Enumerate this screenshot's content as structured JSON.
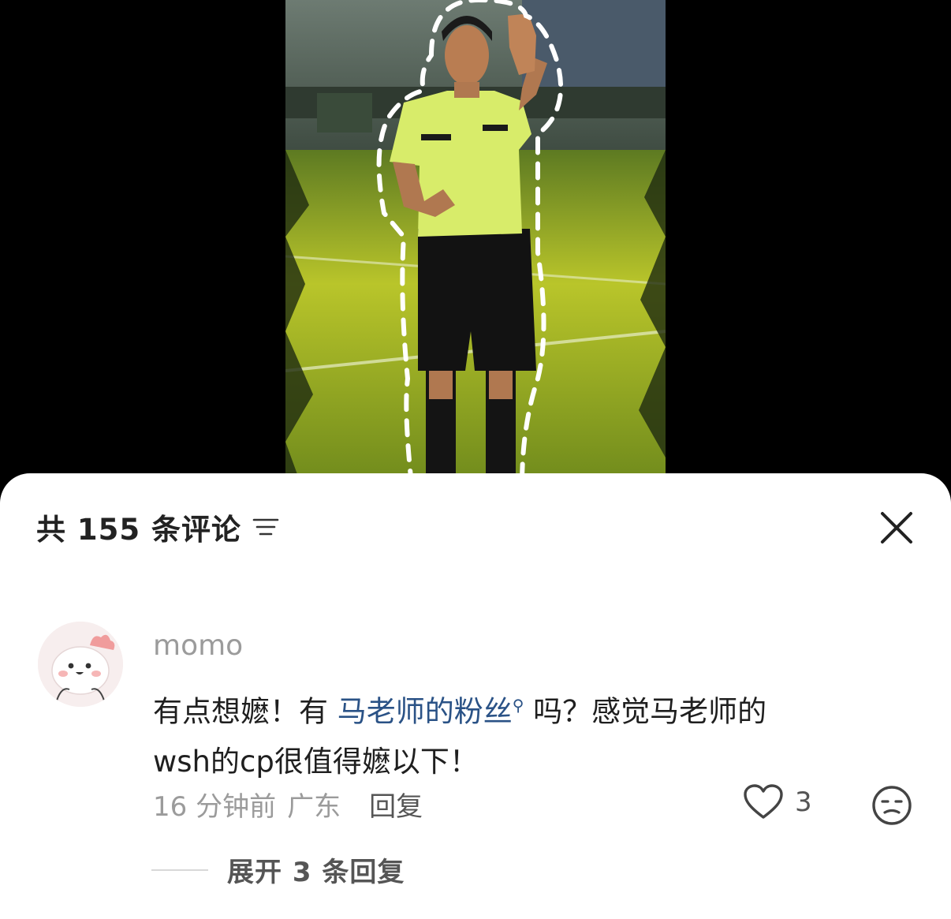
{
  "sheet": {
    "comment_count_label": "共 155 条评论"
  },
  "icons": {
    "sort": "sort-lines-icon",
    "close": "close-icon",
    "like": "heart-outline-icon",
    "dislike": "meh-face-icon",
    "search_hint": "search-icon"
  },
  "comment": {
    "username": "momo",
    "text_before": "有点想嬷！有 ",
    "mention": "马老师的粉丝",
    "text_after": " 吗？感觉马老师的",
    "text_line2": "wsh的cp很值得嬷以下！",
    "time": "16 分钟前",
    "location": "广东",
    "reply_label": "回复",
    "like_count": "3",
    "expand_label": "展开 3 条回复"
  },
  "colors": {
    "mention": "#2a5286",
    "meta_gray": "#9b9b9b",
    "sheet_bg": "#ffffff",
    "backdrop": "#000000"
  }
}
